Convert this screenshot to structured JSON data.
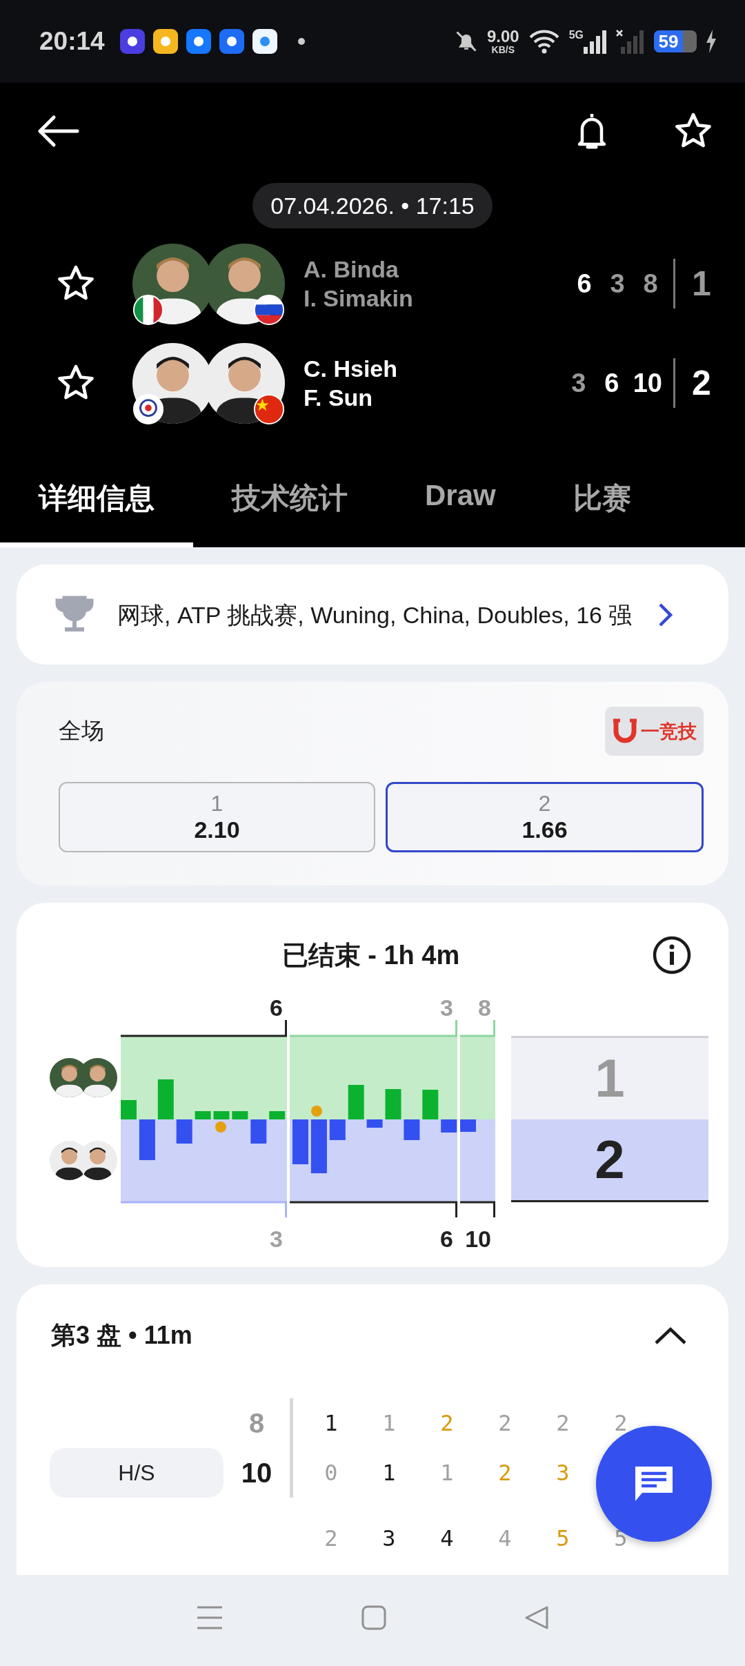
{
  "status_bar": {
    "time": "20:14",
    "speed": "9.00",
    "speed_unit": "KB/S",
    "network": "5G",
    "battery": "59"
  },
  "match": {
    "date": "07.04.2026. • 17:15"
  },
  "teams": [
    {
      "players": [
        "A. Binda",
        "I. Simakin"
      ],
      "favorite": false,
      "winner": false,
      "sets": [
        {
          "score": "6",
          "won": true
        },
        {
          "score": "3",
          "won": false
        },
        {
          "score": "8",
          "won": false
        }
      ],
      "total": "1"
    },
    {
      "players": [
        "C. Hsieh",
        "F. Sun"
      ],
      "favorite": false,
      "winner": true,
      "sets": [
        {
          "score": "3",
          "won": false
        },
        {
          "score": "6",
          "won": true
        },
        {
          "score": "10",
          "won": true
        }
      ],
      "total": "2"
    }
  ],
  "tabs": [
    {
      "label": "详细信息",
      "selected": true
    },
    {
      "label": "技术统计",
      "selected": false
    },
    {
      "label": "Draw",
      "selected": false
    },
    {
      "label": "比赛",
      "selected": false
    }
  ],
  "tournament": {
    "text": "网球, ATP 挑战赛, Wuning, China, Doubles, 16 强"
  },
  "odds": {
    "title": "全场",
    "provider": "一竞技",
    "options": [
      {
        "label": "1",
        "value": "2.10",
        "selected": false
      },
      {
        "label": "2",
        "value": "1.66",
        "selected": true
      }
    ]
  },
  "momentum": {
    "title": "已结束 - 1h 4m",
    "sets": [
      {
        "team1": "6",
        "team2": "3",
        "team1_won": true
      },
      {
        "team1": "3",
        "team2": "6",
        "team1_won": false
      },
      {
        "team1": "8",
        "team2": "10",
        "team1_won": false
      }
    ],
    "totals": [
      {
        "value": "1",
        "won": false
      },
      {
        "value": "2",
        "won": true
      }
    ]
  },
  "set_detail": {
    "title": "第3 盘 • 11m",
    "expanded": true,
    "label": "H/S",
    "scores": [
      {
        "value": "8",
        "won": false
      },
      {
        "value": "10",
        "won": true
      }
    ],
    "rows": [
      {
        "cells": [
          {
            "value": "1",
            "color": "#1a1a1a"
          },
          {
            "value": "1",
            "color": "#a0a0a0"
          },
          {
            "value": "2",
            "color": "#d89a0c"
          },
          {
            "value": "2",
            "color": "#a0a0a0"
          },
          {
            "value": "2",
            "color": "#a0a0a0"
          },
          {
            "value": "2",
            "color": "#a0a0a0"
          }
        ]
      },
      {
        "cells": [
          {
            "value": "0",
            "color": "#a0a0a0"
          },
          {
            "value": "1",
            "color": "#1a1a1a"
          },
          {
            "value": "1",
            "color": "#a0a0a0"
          },
          {
            "value": "2",
            "color": "#d89a0c"
          },
          {
            "value": "3",
            "color": "#d89a0c"
          }
        ]
      },
      {
        "cells": [
          {
            "value": "2",
            "color": "#a0a0a0"
          },
          {
            "value": "3",
            "color": "#1a1a1a"
          },
          {
            "value": "4",
            "color": "#1a1a1a"
          },
          {
            "value": "4",
            "color": "#a0a0a0"
          },
          {
            "value": "5",
            "color": "#d89a0c"
          },
          {
            "value": "5",
            "color": "#a0a0a0"
          }
        ]
      }
    ]
  }
}
